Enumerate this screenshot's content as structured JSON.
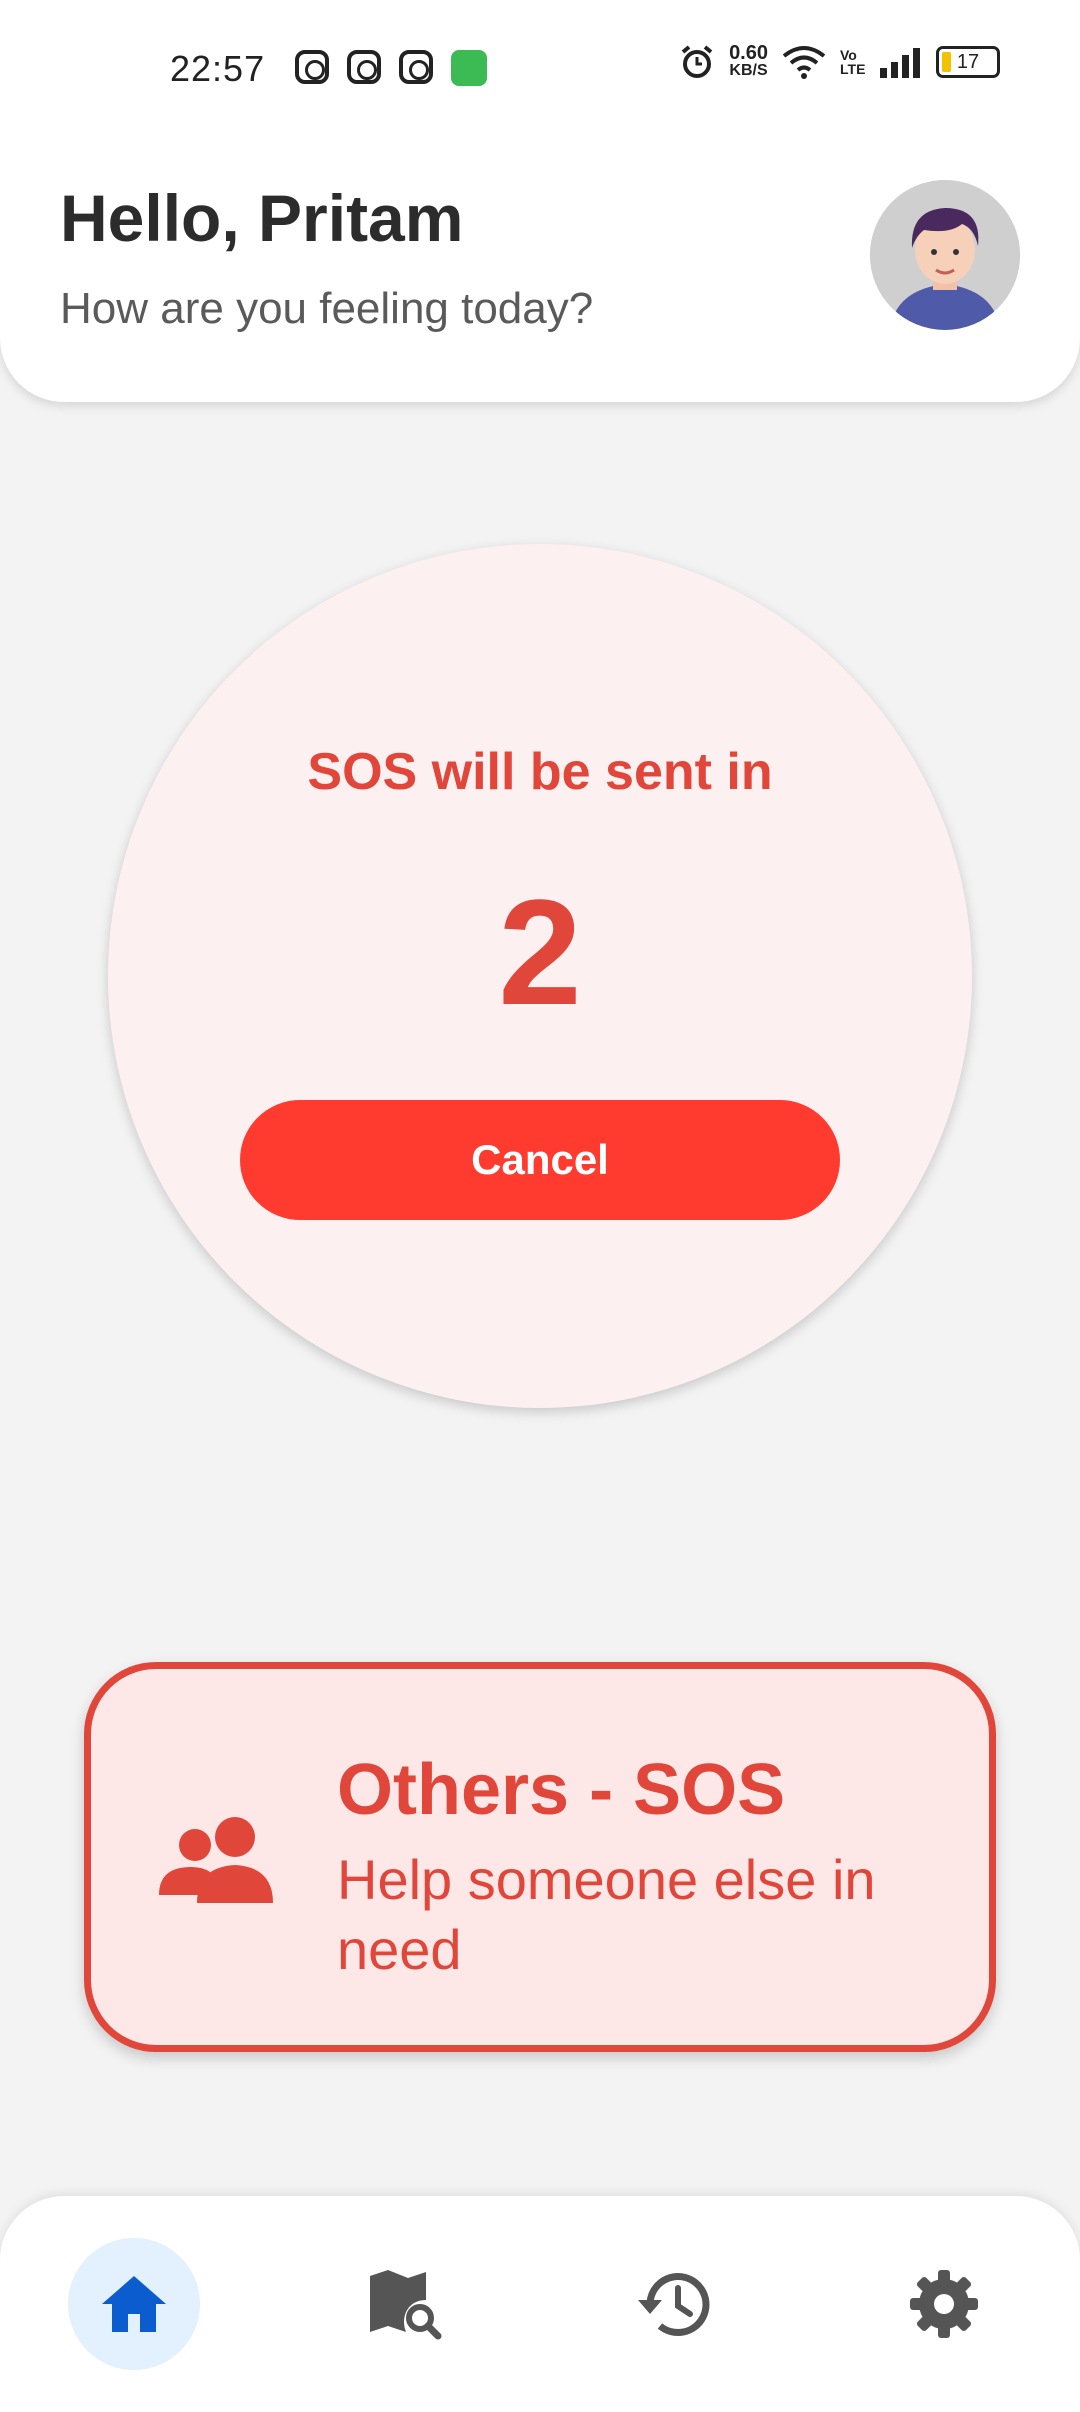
{
  "status_bar": {
    "time": "22:57",
    "net_speed_value": "0.60",
    "net_speed_unit": "KB/S",
    "volte": "Vo LTE",
    "battery": "17"
  },
  "header": {
    "greeting": "Hello, Pritam",
    "subtitle": "How are you feeling today?",
    "avatar_icon": "user-avatar"
  },
  "sos": {
    "label": "SOS will be sent in",
    "countdown": "2",
    "cancel_label": "Cancel"
  },
  "others_sos": {
    "title": "Others - SOS",
    "subtitle": "Help someone else in need",
    "icon": "group-icon"
  },
  "bottom_nav": {
    "items": [
      {
        "icon": "home-icon",
        "active": true
      },
      {
        "icon": "map-search-icon",
        "active": false
      },
      {
        "icon": "history-icon",
        "active": false
      },
      {
        "icon": "settings-icon",
        "active": false
      }
    ]
  },
  "colors": {
    "accent_red": "#e0463a",
    "button_red": "#ff3b30",
    "nav_active_blue": "#0b5ccf"
  }
}
